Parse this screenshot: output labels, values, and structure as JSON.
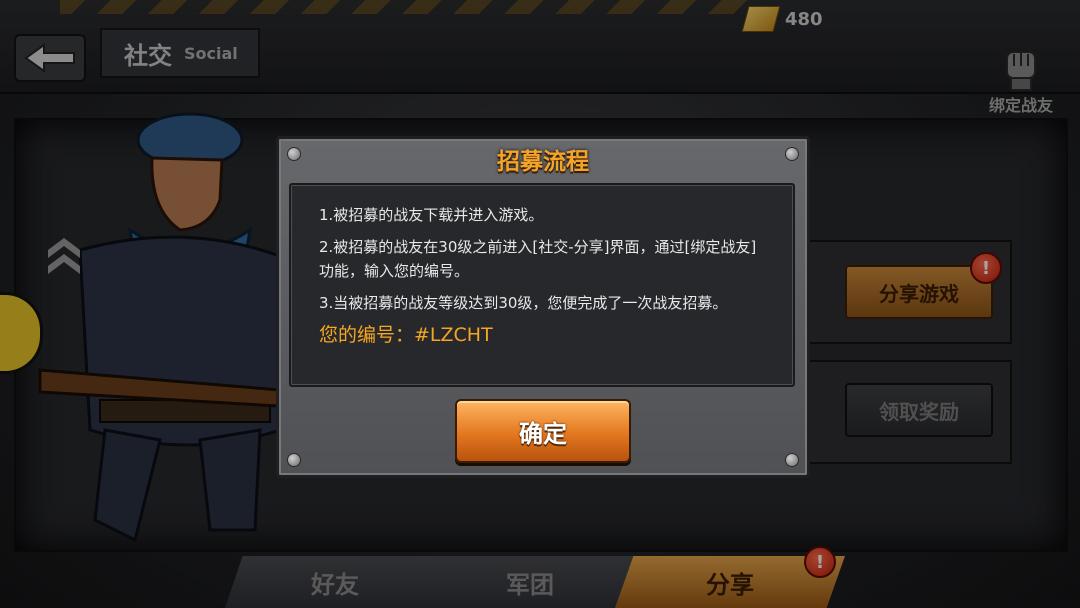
{
  "header": {
    "title_cn": "社交",
    "title_en": "Social",
    "gold_amount": "480",
    "bind_friend_label": "绑定战友"
  },
  "side_panel": {
    "share_game_label": "分享游戏",
    "claim_reward_label": "领取奖励",
    "alert_mark": "!"
  },
  "tabs": [
    {
      "label": "好友",
      "active": false
    },
    {
      "label": "军团",
      "active": false
    },
    {
      "label": "分享",
      "active": true
    }
  ],
  "modal": {
    "title": "招募流程",
    "steps": [
      "1.被招募的战友下载并进入游戏。",
      "2.被招募的战友在30级之前进入[社交-分享]界面，通过[绑定战友]功能，输入您的编号。",
      "3.当被招募的战友等级达到30级，您便完成了一次战友招募。"
    ],
    "code_label": "您的编号：#LZCHT",
    "confirm_label": "确定"
  },
  "colors": {
    "accent_orange": "#f3a42a",
    "alert_red": "#d0260e",
    "gold": "#e0b040"
  },
  "icons": [
    "back-arrow-icon",
    "gold-bar-icon",
    "fist-icon",
    "alert-icon",
    "badge-icon"
  ]
}
